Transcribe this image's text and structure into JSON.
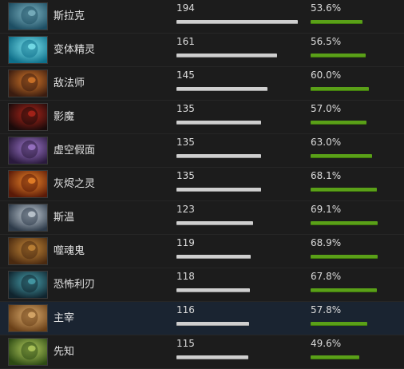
{
  "heroes": [
    {
      "name": "斯拉克",
      "matches": "194",
      "win_rate": "53.6%",
      "matches_value": 194,
      "win_rate_value": 53.6,
      "icon": "slark-portrait-icon",
      "c1": "#1d4e63",
      "c2": "#7fb6c4"
    },
    {
      "name": "变体精灵",
      "matches": "161",
      "win_rate": "56.5%",
      "matches_value": 161,
      "win_rate_value": 56.5,
      "icon": "morphling-portrait-icon",
      "c1": "#0f6f8a",
      "c2": "#7fe6f0"
    },
    {
      "name": "敌法师",
      "matches": "145",
      "win_rate": "60.0%",
      "matches_value": 145,
      "win_rate_value": 60.0,
      "icon": "anti-mage-portrait-icon",
      "c1": "#3a1c10",
      "c2": "#d97a2a"
    },
    {
      "name": "影魔",
      "matches": "135",
      "win_rate": "57.0%",
      "matches_value": 135,
      "win_rate_value": 57.0,
      "icon": "shadow-fiend-portrait-icon",
      "c1": "#1a0a0a",
      "c2": "#b3261a"
    },
    {
      "name": "虚空假面",
      "matches": "135",
      "win_rate": "63.0%",
      "matches_value": 135,
      "win_rate_value": 63.0,
      "icon": "faceless-void-portrait-icon",
      "c1": "#2a1a3d",
      "c2": "#a27ad0"
    },
    {
      "name": "灰烬之灵",
      "matches": "135",
      "win_rate": "68.1%",
      "matches_value": 135,
      "win_rate_value": 68.1,
      "icon": "ember-spirit-portrait-icon",
      "c1": "#5a1a08",
      "c2": "#f0882a"
    },
    {
      "name": "斯温",
      "matches": "123",
      "win_rate": "69.1%",
      "matches_value": 123,
      "win_rate_value": 69.1,
      "icon": "sven-portrait-icon",
      "c1": "#2e3b4a",
      "c2": "#c9d2da"
    },
    {
      "name": "噬魂鬼",
      "matches": "119",
      "win_rate": "68.9%",
      "matches_value": 119,
      "win_rate_value": 68.9,
      "icon": "lifestealer-portrait-icon",
      "c1": "#4a2a10",
      "c2": "#c78a3a"
    },
    {
      "name": "恐怖利刃",
      "matches": "118",
      "win_rate": "67.8%",
      "matches_value": 118,
      "win_rate_value": 67.8,
      "icon": "terrorblade-portrait-icon",
      "c1": "#10242e",
      "c2": "#4aa4b0"
    },
    {
      "name": "主宰",
      "matches": "116",
      "win_rate": "57.8%",
      "matches_value": 116,
      "win_rate_value": 57.8,
      "icon": "juggernaut-portrait-icon",
      "c1": "#6a4018",
      "c2": "#e0b070"
    },
    {
      "name": "先知",
      "matches": "115",
      "win_rate": "49.6%",
      "matches_value": 115,
      "win_rate_value": 49.6,
      "icon": "natures-prophet-portrait-icon",
      "c1": "#2d4a14",
      "c2": "#b8d060"
    }
  ],
  "scale": {
    "matches_max": 194,
    "win_rate_max": 100
  },
  "colors": {
    "background": "#1c1c1c",
    "highlight_row": "#1a2431",
    "count_bar": "#cfcfcf",
    "rate_bar": "#5aa018"
  },
  "highlighted_row": 9
}
